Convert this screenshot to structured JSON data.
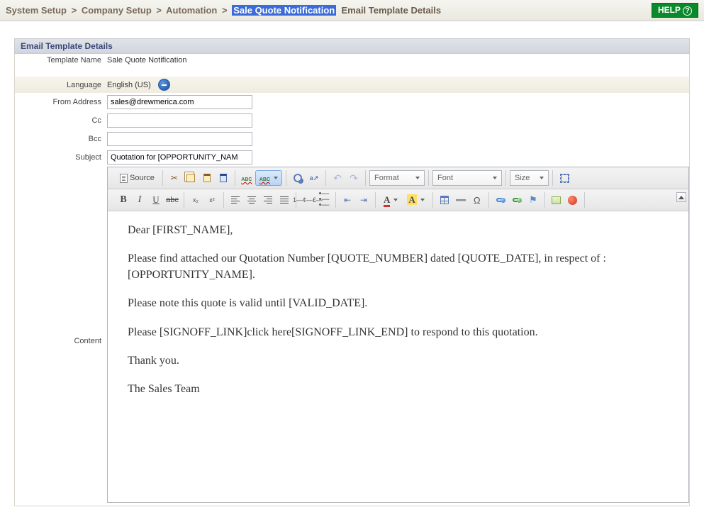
{
  "breadcrumb": {
    "root": "System Setup",
    "l2": "Company Setup",
    "l3": "Automation",
    "l4": "Sale Quote Notification",
    "tail": "Email Template Details"
  },
  "help_label": "HELP",
  "section_title": "Email Template Details",
  "labels": {
    "template_name": "Template Name",
    "language": "Language",
    "from": "From Address",
    "cc": "Cc",
    "bcc": "Bcc",
    "subject": "Subject",
    "content": "Content"
  },
  "values": {
    "template_name": "Sale Quote Notification",
    "language": "English (US)",
    "from": "sales@drewmerica.com",
    "cc": "",
    "bcc": "",
    "subject": "Quotation for [OPPORTUNITY_NAM"
  },
  "toolbar": {
    "source": "Source",
    "format": "Format",
    "font": "Font",
    "size": "Size",
    "bold": "B",
    "italic": "I",
    "underline": "U",
    "strike": "abc",
    "sub": "x₂",
    "sup": "x²"
  },
  "editor_body": {
    "p1": "Dear [FIRST_NAME],",
    "p2": "Please find attached our Quotation Number [QUOTE_NUMBER] dated [QUOTE_DATE], in respect of : [OPPORTUNITY_NAME].",
    "p3": "Please note this quote is valid until [VALID_DATE].",
    "p4": "Please [SIGNOFF_LINK]click here[SIGNOFF_LINK_END] to respond to this quotation.",
    "p5": "Thank you.",
    "p6": "The Sales Team"
  }
}
